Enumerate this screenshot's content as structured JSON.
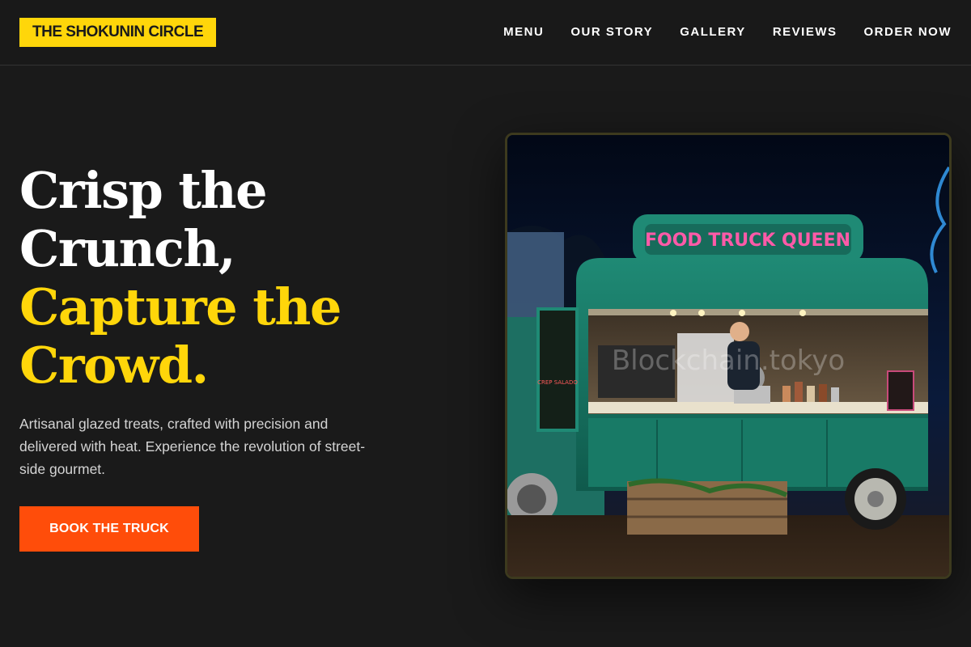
{
  "brand": {
    "logo_text": "THE SHOKUNIN CIRCLE",
    "accent": "#ffd60a",
    "cta_color": "#ff4d0a",
    "background": "#1a1a1a"
  },
  "nav": {
    "links": [
      {
        "label": "MENU"
      },
      {
        "label": "OUR STORY"
      },
      {
        "label": "GALLERY"
      },
      {
        "label": "REVIEWS"
      },
      {
        "label": "ORDER NOW"
      }
    ]
  },
  "hero": {
    "title_line1": "Crisp the",
    "title_line2": "Crunch,",
    "title_accent_line1": "Capture the",
    "title_accent_line2": "Crowd.",
    "subtitle": "Artisanal glazed treats, crafted with precision and delivered with heat. Experience the revolution of street-side gourmet.",
    "cta_label": "BOOK THE TRUCK"
  },
  "photo": {
    "sign_text": "FOOD TRUCK QUEEN",
    "menu_board_text": "CREP SALADO",
    "watermark": "Blockchain.tokyo"
  }
}
